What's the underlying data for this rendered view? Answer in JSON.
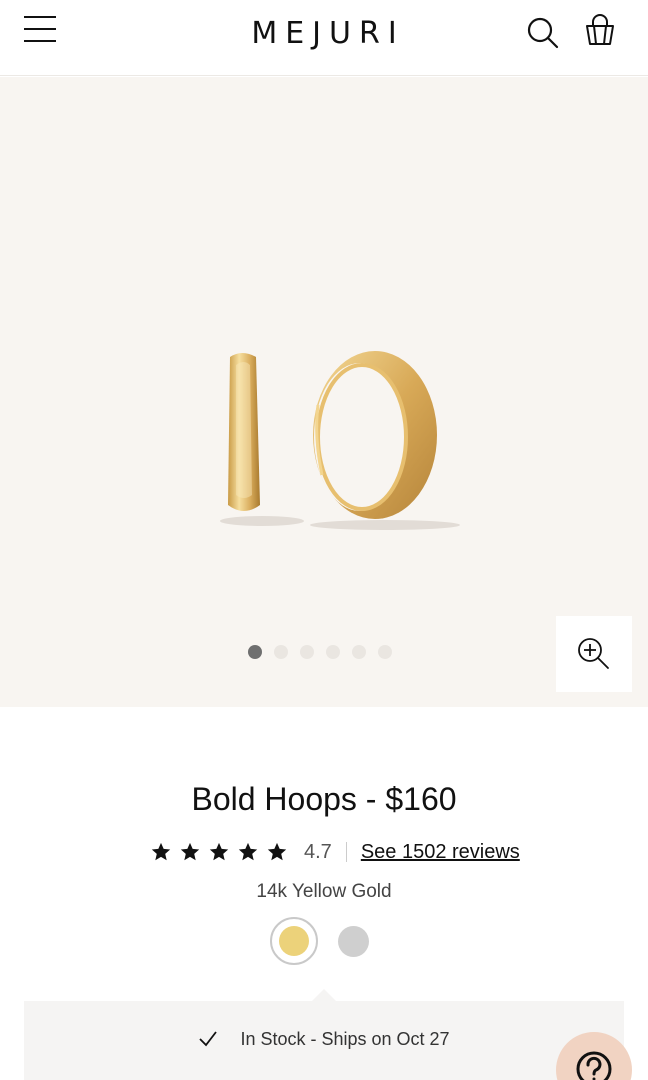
{
  "header": {
    "brand": "MEJURI",
    "icons": {
      "menu": "hamburger-menu-icon",
      "search": "search-icon",
      "bag": "shopping-bag-icon"
    }
  },
  "gallery": {
    "image_alt": "Bold Hoops earrings",
    "total_images": 6,
    "active_index": 0,
    "zoom_icon": "zoom-in-icon"
  },
  "product": {
    "title": "Bold Hoops - $160",
    "rating": "4.7",
    "stars": 5,
    "reviews_link": "See 1502 reviews",
    "material": "14k Yellow Gold",
    "swatches": [
      {
        "name": "Yellow Gold",
        "color": "#ecd27a",
        "selected": true
      },
      {
        "name": "Silver",
        "color": "#cfcfcf",
        "selected": false
      }
    ]
  },
  "stock": {
    "text": "In Stock - Ships on Oct 27",
    "icon": "checkmark-icon"
  },
  "help": {
    "icon": "help-question-icon"
  },
  "colors": {
    "gallery_bg": "#f8f5f1",
    "gold": "#ecd27a",
    "help_bg": "#f1d3c2"
  }
}
